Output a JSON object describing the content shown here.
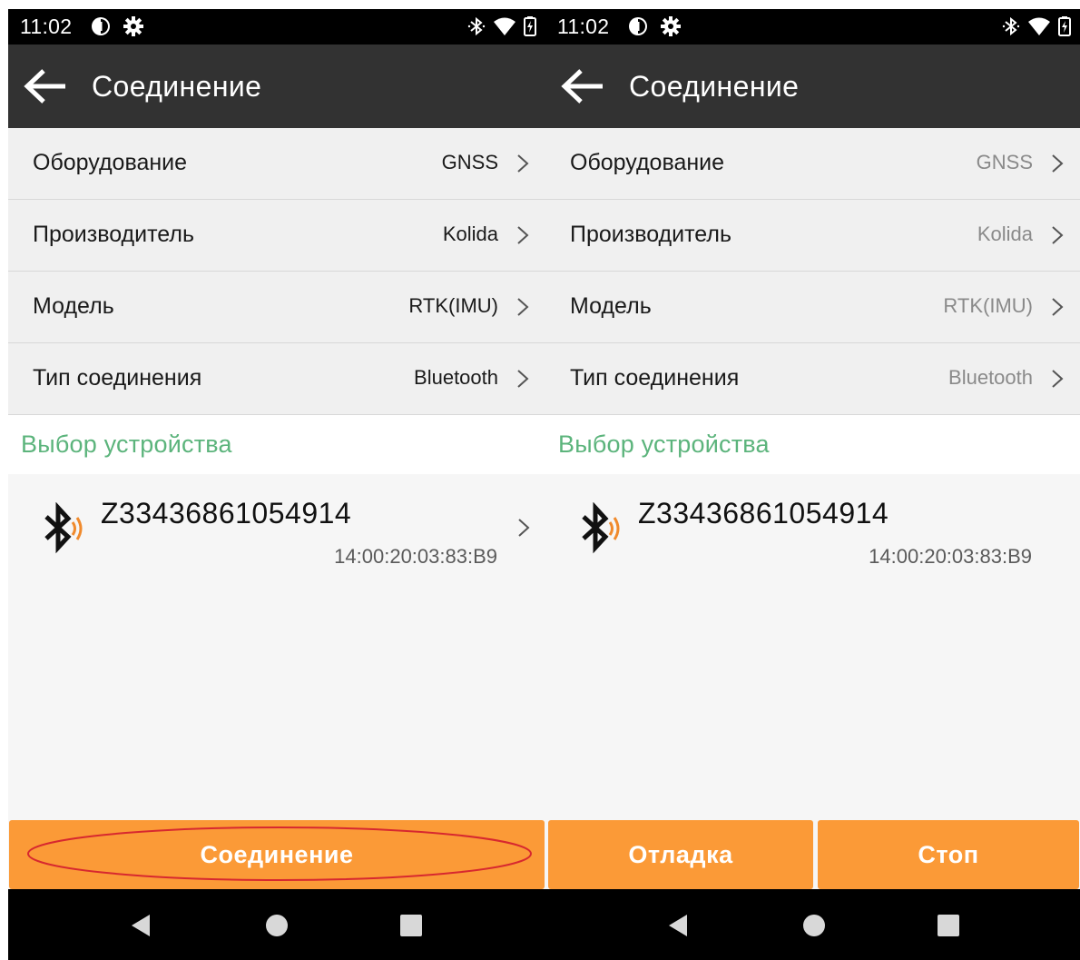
{
  "status_bar": {
    "time": "11:02"
  },
  "app_bar": {
    "title": "Соединение"
  },
  "settings": [
    {
      "label": "Оборудование",
      "value": "GNSS"
    },
    {
      "label": "Производитель",
      "value": "Kolida"
    },
    {
      "label": "Модель",
      "value": "RTK(IMU)"
    },
    {
      "label": "Тип соединения",
      "value": "Bluetooth"
    }
  ],
  "section": {
    "title": "Выбор устройства"
  },
  "device": {
    "name": "Z33436861054914",
    "mac": "14:00:20:03:83:B9"
  },
  "buttons": {
    "connect": "Соединение",
    "debug": "Отладка",
    "stop": "Стоп"
  },
  "colors": {
    "accent_orange": "#fb9a37",
    "section_green": "#5cb47c",
    "app_bar": "#323232",
    "highlight_red": "#d7282f",
    "bt_signal_orange": "#f08a2c"
  },
  "icons": {
    "back": "arrow-left-icon",
    "chevron": "chevron-right-icon",
    "bluetooth_device": "bluetooth-signal-icon",
    "status_left": [
      "data-saver-icon",
      "gear-icon"
    ],
    "status_right": [
      "bluetooth-icon",
      "wifi-icon",
      "battery-charging-icon"
    ],
    "nav": [
      "nav-back-icon",
      "nav-home-icon",
      "nav-recent-icon"
    ]
  }
}
